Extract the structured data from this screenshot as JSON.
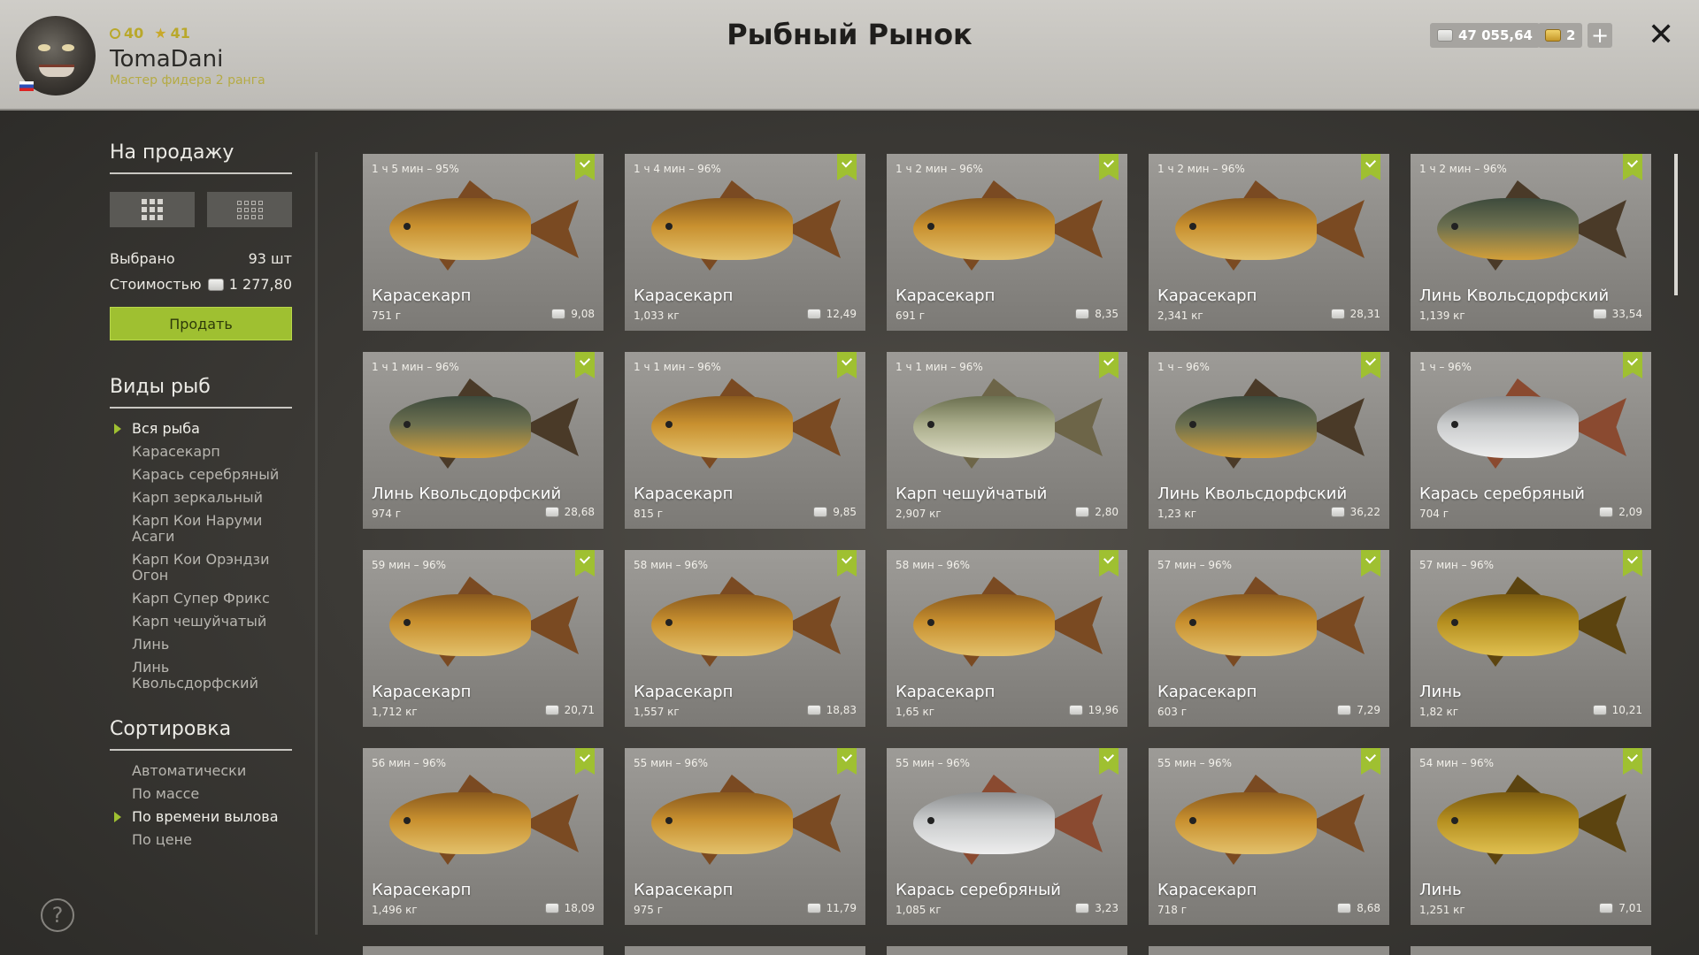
{
  "header": {
    "player": {
      "level1": "40",
      "level2": "41",
      "name": "TomaDani",
      "rank": "Мастер фидера 2 ранга"
    },
    "title": "Рыбный Рынок",
    "silver": "47 055,64",
    "gold": "2"
  },
  "sidebar": {
    "sale_heading": "На продажу",
    "selected_label": "Выбрано",
    "selected_value": "93 шт",
    "cost_label": "Стоимостью",
    "cost_value": "1 277,80",
    "sell_button": "Продать",
    "species_heading": "Виды рыб",
    "species": [
      "Вся рыба",
      "Карасекарп",
      "Карась серебряный",
      "Карп зеркальный",
      "Карп Кои Наруми Асаги",
      "Карп Кои Орэндзи Огон",
      "Карп Супер Фрикс",
      "Карп чешуйчатый",
      "Линь",
      "Линь Квольсдорфский"
    ],
    "species_active": 0,
    "sort_heading": "Сортировка",
    "sort": [
      "Автоматически",
      "По массе",
      "По времени вылова",
      "По цене"
    ],
    "sort_active": 2
  },
  "colors": {
    "accent": "#9fc031"
  },
  "cards": [
    {
      "time": "1 ч 5 мин – 95%",
      "name": "Карасекарп",
      "weight": "751 г",
      "price": "9,08"
    },
    {
      "time": "1 ч 4 мин – 96%",
      "name": "Карасекарп",
      "weight": "1,033 кг",
      "price": "12,49"
    },
    {
      "time": "1 ч 2 мин – 96%",
      "name": "Карасекарп",
      "weight": "691 г",
      "price": "8,35"
    },
    {
      "time": "1 ч 2 мин – 96%",
      "name": "Карасекарп",
      "weight": "2,341 кг",
      "price": "28,31"
    },
    {
      "time": "1 ч 2 мин – 96%",
      "name": "Линь Квольсдорфский",
      "weight": "1,139 кг",
      "price": "33,54"
    },
    {
      "time": "1 ч 1 мин – 96%",
      "name": "Линь Квольсдорфский",
      "weight": "974 г",
      "price": "28,68"
    },
    {
      "time": "1 ч 1 мин – 96%",
      "name": "Карасекарп",
      "weight": "815 г",
      "price": "9,85"
    },
    {
      "time": "1 ч 1 мин – 96%",
      "name": "Карп чешуйчатый",
      "weight": "2,907 кг",
      "price": "2,80"
    },
    {
      "time": "1 ч – 96%",
      "name": "Линь Квольсдорфский",
      "weight": "1,23 кг",
      "price": "36,22"
    },
    {
      "time": "1 ч – 96%",
      "name": "Карась серебряный",
      "weight": "704 г",
      "price": "2,09"
    },
    {
      "time": "59 мин – 96%",
      "name": "Карасекарп",
      "weight": "1,712 кг",
      "price": "20,71"
    },
    {
      "time": "58 мин – 96%",
      "name": "Карасекарп",
      "weight": "1,557 кг",
      "price": "18,83"
    },
    {
      "time": "58 мин – 96%",
      "name": "Карасекарп",
      "weight": "1,65 кг",
      "price": "19,96"
    },
    {
      "time": "57 мин – 96%",
      "name": "Карасекарп",
      "weight": "603 г",
      "price": "7,29"
    },
    {
      "time": "57 мин – 96%",
      "name": "Линь",
      "weight": "1,82 кг",
      "price": "10,21"
    },
    {
      "time": "56 мин – 96%",
      "name": "Карасекарп",
      "weight": "1,496 кг",
      "price": "18,09"
    },
    {
      "time": "55 мин – 96%",
      "name": "Карасекарп",
      "weight": "975 г",
      "price": "11,79"
    },
    {
      "time": "55 мин – 96%",
      "name": "Карась серебряный",
      "weight": "1,085 кг",
      "price": "3,23"
    },
    {
      "time": "55 мин – 96%",
      "name": "Карасекарп",
      "weight": "718 г",
      "price": "8,68"
    },
    {
      "time": "54 мин – 96%",
      "name": "Линь",
      "weight": "1,251 кг",
      "price": "7,01"
    }
  ]
}
